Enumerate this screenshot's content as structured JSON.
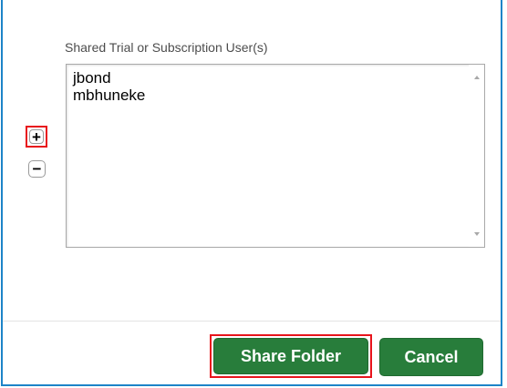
{
  "dialog": {
    "field_label": "Shared Trial or Subscription User(s)",
    "users": [
      "jbond",
      "mbhuneke"
    ],
    "add_symbol": "+",
    "remove_symbol": "−",
    "share_button_label": "Share Folder",
    "cancel_button_label": "Cancel"
  },
  "icons": {
    "add": "plus-icon",
    "remove": "minus-icon",
    "scroll_up": "scroll-up-arrow-icon",
    "scroll_down": "scroll-down-arrow-icon"
  },
  "colors": {
    "frame_border": "#1d84c8",
    "button_green": "#287d3b",
    "highlight_red": "#e8141c"
  }
}
